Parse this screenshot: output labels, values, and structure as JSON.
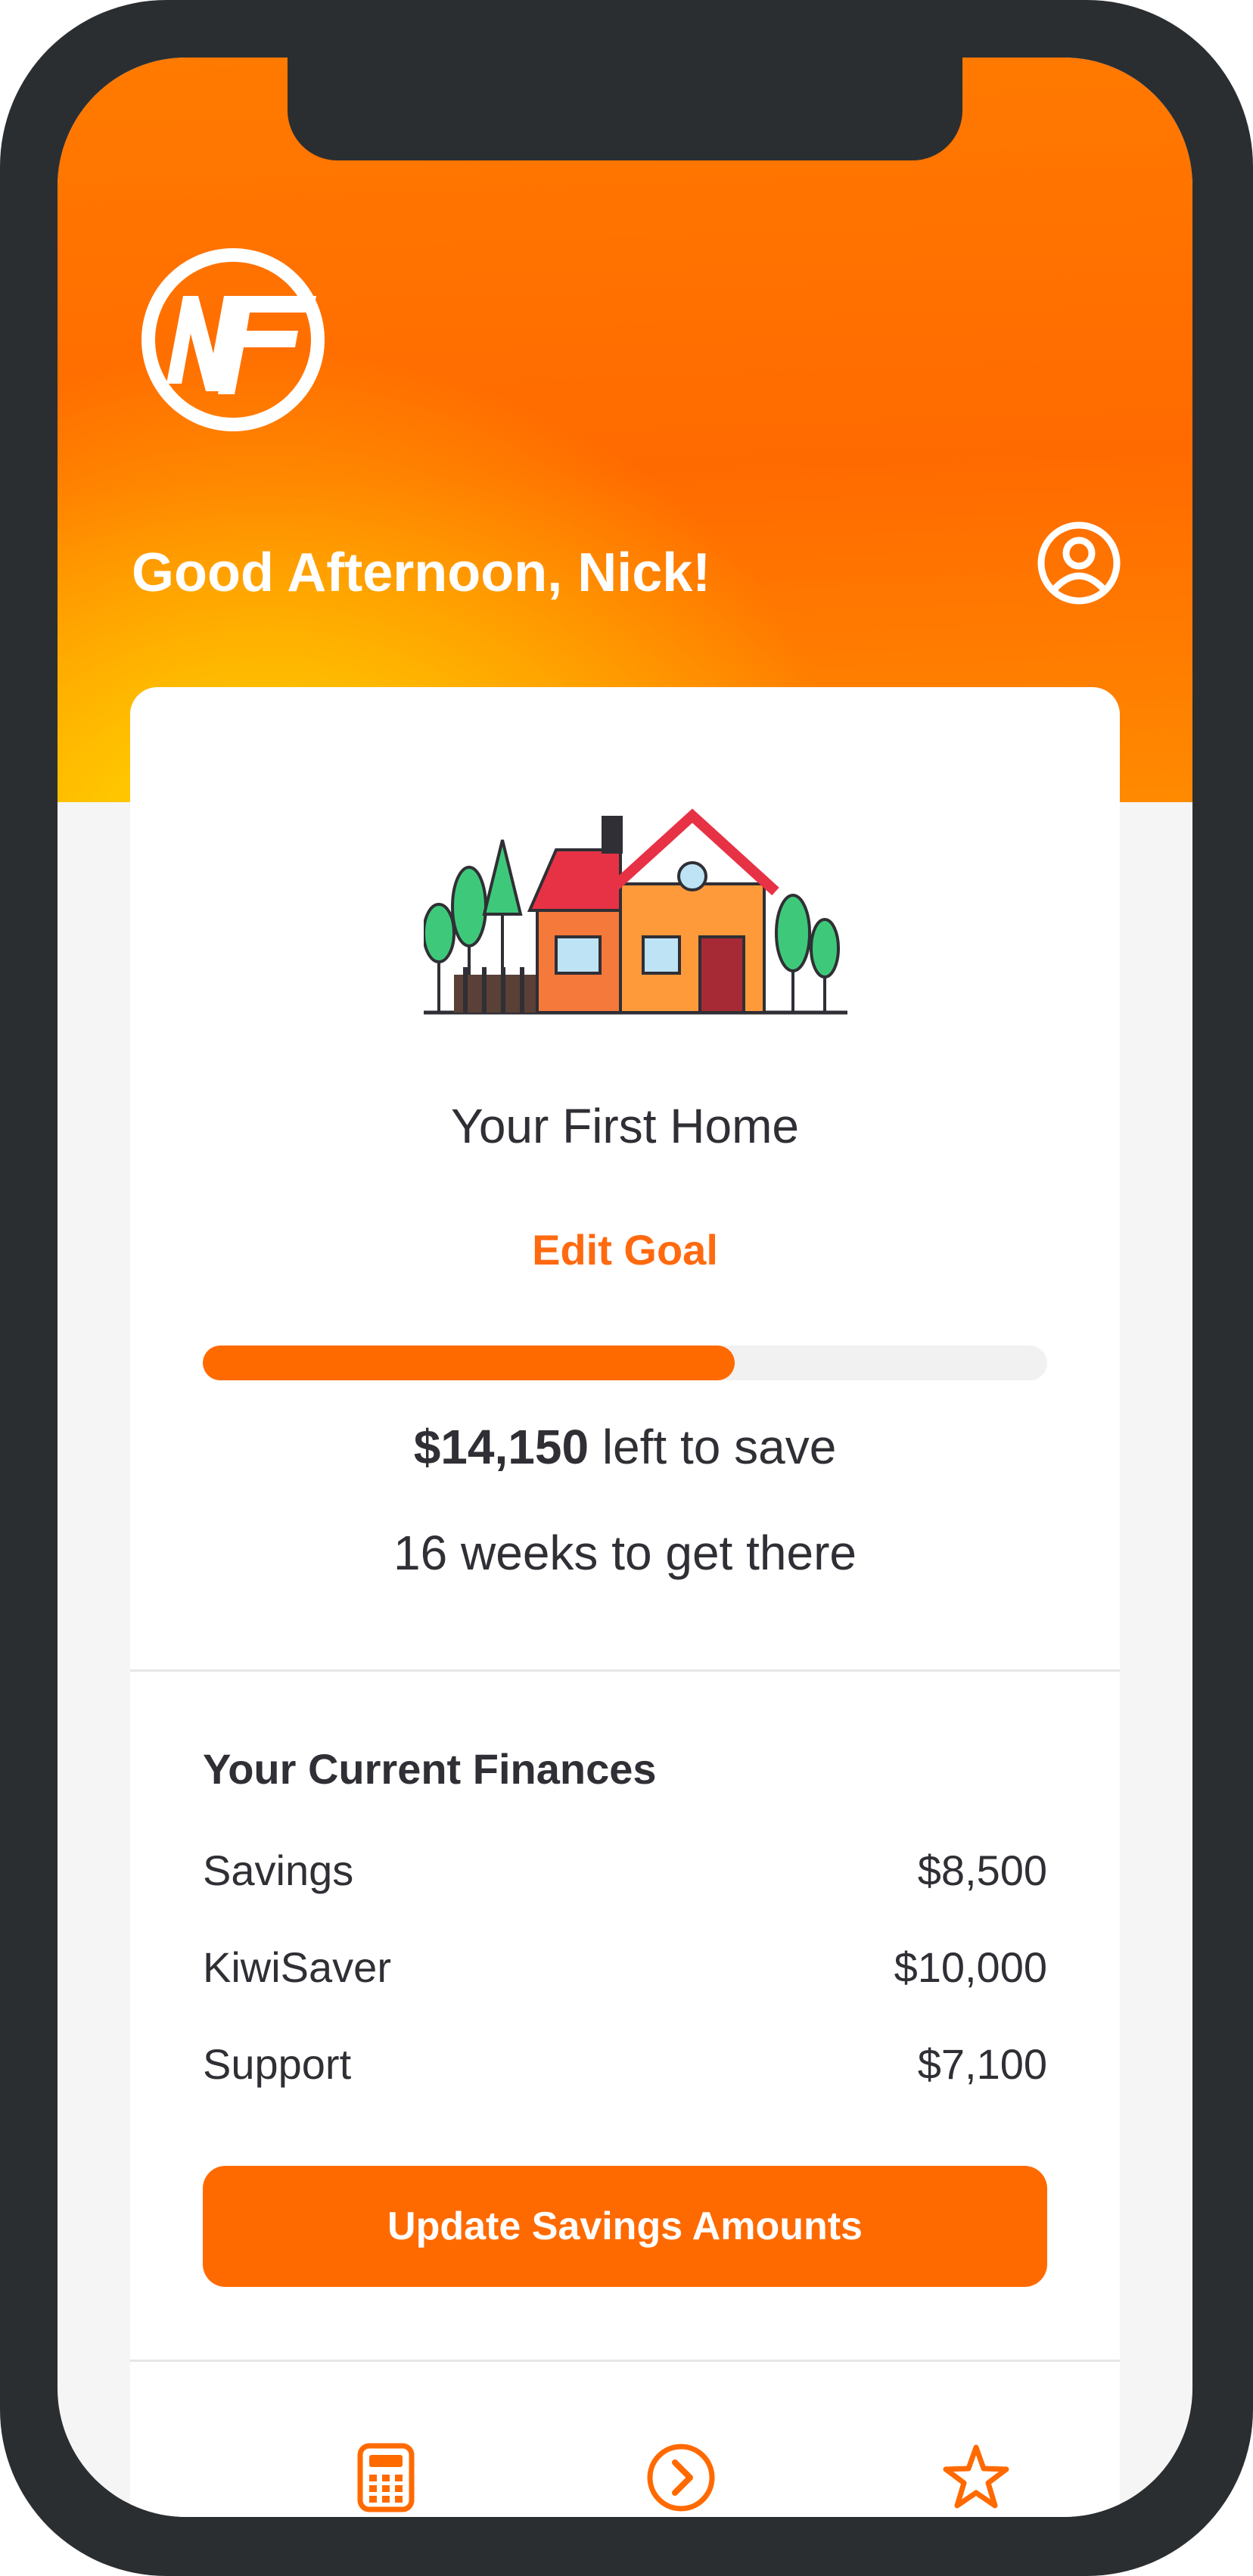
{
  "header": {
    "greeting": "Good Afternoon, Nick!"
  },
  "goal": {
    "title": "Your First Home",
    "edit_label": "Edit Goal",
    "progress_fraction": 0.63,
    "amount_left": "$14,150",
    "left_suffix": " left to save",
    "weeks_text": "16 weeks to get there"
  },
  "finances": {
    "title": "Your Current Finances",
    "rows": [
      {
        "label": "Savings",
        "value": "$8,500"
      },
      {
        "label": "KiwiSaver",
        "value": "$10,000"
      },
      {
        "label": "Support",
        "value": "$7,100"
      }
    ],
    "update_button": "Update Savings Amounts"
  },
  "bottom_nav": {
    "icons": [
      "calculator-icon",
      "chevron-right-circle-icon",
      "star-icon"
    ]
  },
  "colors": {
    "accent": "#ff6a00",
    "header_top": "#ff6a00",
    "header_glow": "#ffd000",
    "text": "#2f2f35",
    "frame": "#2b2e31"
  }
}
